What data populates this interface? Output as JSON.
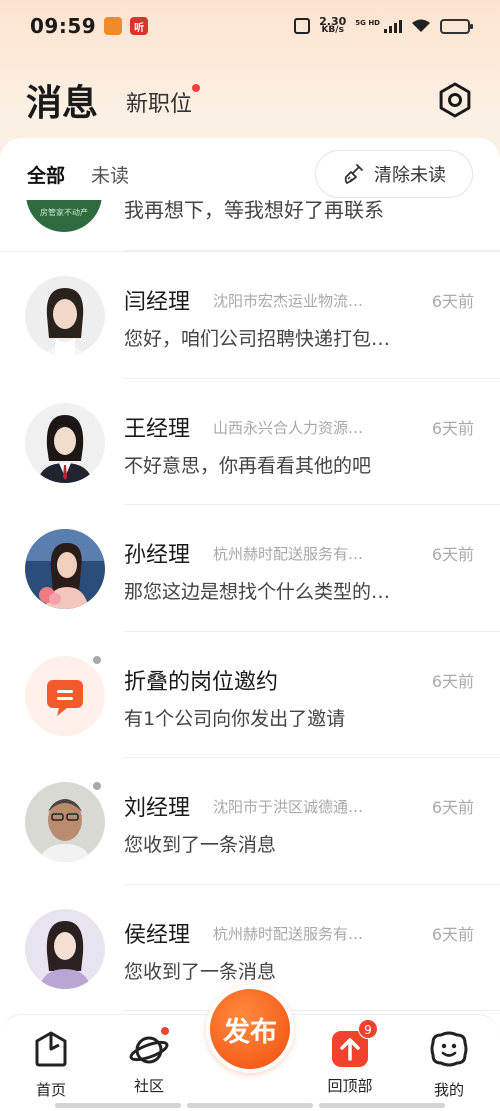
{
  "status_bar": {
    "time": "09:59",
    "app_icon_1": "",
    "app_icon_2": "听",
    "net_speed": "2.30",
    "net_unit": "KB/s",
    "network_type": "5G HD"
  },
  "header": {
    "title": "消息",
    "new_jobs_tab": "新职位"
  },
  "filters": {
    "all": "全部",
    "unread": "未读",
    "clear_button": "清除未读"
  },
  "partial_item": {
    "avatar_text": "房管家不动产",
    "message": "我再想下，等我想好了再联系"
  },
  "messages": [
    {
      "name": "闫经理",
      "company": "沈阳市宏杰运业物流…",
      "time": "6天前",
      "message": "您好，咱们公司招聘快递打包…",
      "unread": false
    },
    {
      "name": "王经理",
      "company": "山西永兴合人力资源…",
      "time": "6天前",
      "message": "不好意思，你再看看其他的吧",
      "unread": false
    },
    {
      "name": "孙经理",
      "company": "杭州赫时配送服务有…",
      "time": "6天前",
      "message": "那您这边是想找个什么类型的…",
      "unread": false
    },
    {
      "name": "折叠的岗位邀约",
      "company": "",
      "time": "6天前",
      "message": "有1个公司向你发出了邀请",
      "unread": true
    },
    {
      "name": "刘经理",
      "company": "沈阳市于洪区诚德通…",
      "time": "6天前",
      "message": "您收到了一条消息",
      "unread": true
    },
    {
      "name": "侯经理",
      "company": "杭州赫时配送服务有…",
      "time": "6天前",
      "message": "您收到了一条消息",
      "unread": false
    }
  ],
  "bottom_nav": {
    "home": "首页",
    "community": "社区",
    "publish": "发布",
    "back_to_top": "回顶部",
    "back_to_top_badge": "9",
    "mine": "我的"
  },
  "colors": {
    "accent": "#f5601d",
    "badge_red": "#f0422d",
    "unread_dot": "#a9a9a9"
  }
}
